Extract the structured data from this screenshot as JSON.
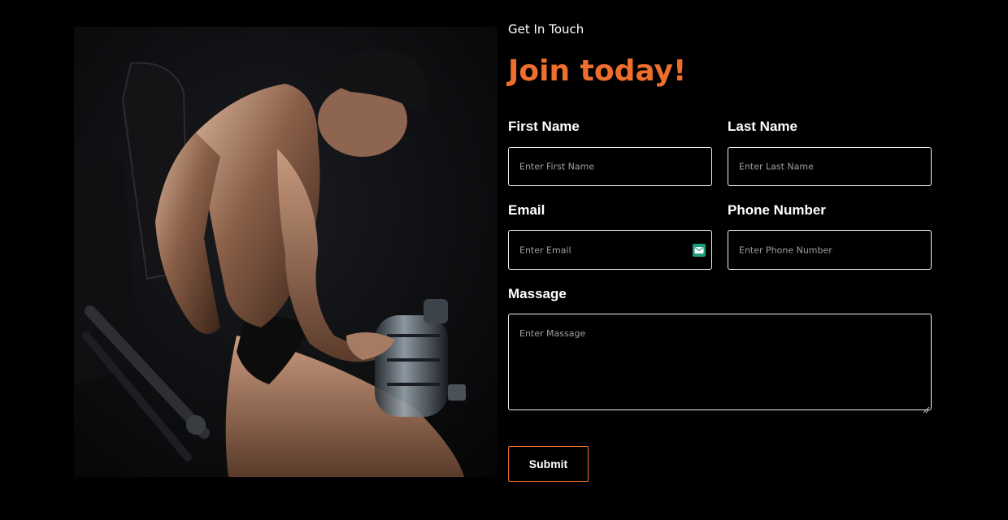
{
  "photo": {
    "alt_icon": "bodybuilder-photo"
  },
  "contact": {
    "eyebrow": "Get In Touch",
    "headline": "Join today!",
    "accent_color": "#ee6f2d",
    "fields": {
      "first_name": {
        "label": "First Name",
        "placeholder": "Enter First Name",
        "value": ""
      },
      "last_name": {
        "label": "Last Name",
        "placeholder": "Enter Last Name",
        "value": ""
      },
      "email": {
        "label": "Email",
        "placeholder": "Enter Email",
        "value": "",
        "icon": "mail-icon"
      },
      "phone": {
        "label": "Phone Number",
        "placeholder": "Enter Phone Number",
        "value": ""
      },
      "message": {
        "label": "Massage",
        "placeholder": "Enter Massage",
        "value": ""
      }
    },
    "submit_label": "Submit"
  }
}
